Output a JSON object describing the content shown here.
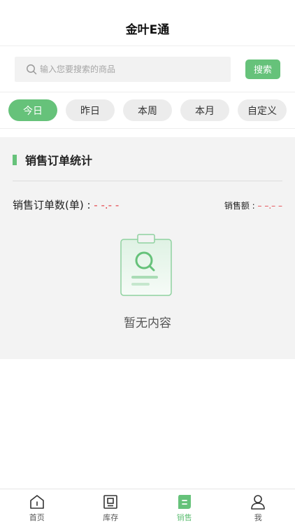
{
  "header": {
    "title": "金叶E通"
  },
  "search": {
    "placeholder": "输入您要搜索的商品",
    "button_label": "搜索"
  },
  "tabs": [
    {
      "label": "今日",
      "active": true
    },
    {
      "label": "昨日",
      "active": false
    },
    {
      "label": "本周",
      "active": false
    },
    {
      "label": "本月",
      "active": false
    },
    {
      "label": "自定义",
      "active": false
    }
  ],
  "stats": {
    "section_title": "销售订单统计",
    "order_count_label": "销售订单数(单) : ",
    "order_count_value": "- -.- -",
    "sales_amount_label": "销售额 : ",
    "sales_amount_value": "– –.– –"
  },
  "empty_state": {
    "text": "暂无内容"
  },
  "bottom_nav": [
    {
      "label": "首页",
      "icon": "home-icon",
      "active": false
    },
    {
      "label": "库存",
      "icon": "inventory-icon",
      "active": false
    },
    {
      "label": "销售",
      "icon": "sales-icon",
      "active": true
    },
    {
      "label": "我",
      "icon": "user-icon",
      "active": false
    }
  ],
  "colors": {
    "accent": "#66c27a",
    "placeholder_dash": "#e5484d",
    "panel_bg": "#f3f3f3"
  }
}
